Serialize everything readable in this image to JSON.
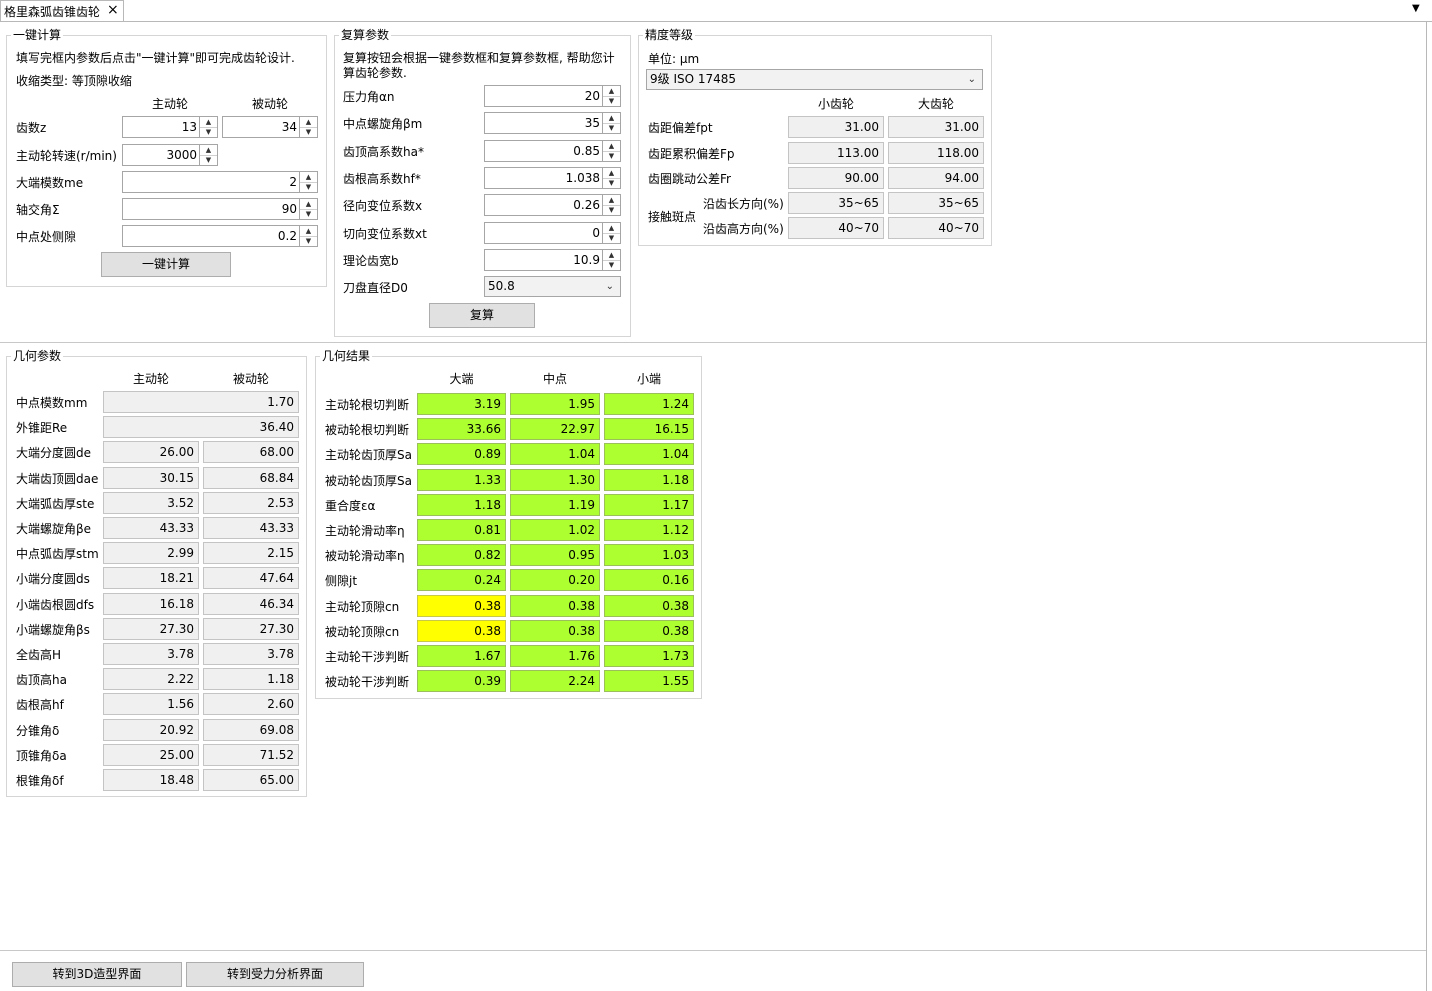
{
  "tab": {
    "title": "格里森弧齿锥齿轮",
    "close": "×"
  },
  "quick_calc": {
    "title": "一键计算",
    "hint": "填写完框内参数后点击\"一键计算\"即可完成齿轮设计.",
    "shrink_type": "收缩类型: 等顶隙收缩",
    "col_drive": "主动轮",
    "col_driven": "被动轮",
    "teeth": {
      "label": "齿数z",
      "drive": "13",
      "driven": "34"
    },
    "speed": {
      "label": "主动轮转速(r/min)",
      "value": "3000"
    },
    "module": {
      "label": "大端模数me",
      "value": "2"
    },
    "shaft_angle": {
      "label": "轴交角Σ",
      "value": "90"
    },
    "backlash": {
      "label": "中点处侧隙",
      "value": "0.2"
    },
    "button": "一键计算"
  },
  "recheck": {
    "title": "复算参数",
    "hint_line1": "复算按钮会根据一键参数框和复算参数框, 帮助您计",
    "hint_line2": "算齿轮参数.",
    "rows": [
      {
        "label": "压力角αn",
        "value": "20"
      },
      {
        "label": "中点螺旋角βm",
        "value": "35"
      },
      {
        "label": "齿顶高系数ha*",
        "value": "0.85"
      },
      {
        "label": "齿根高系数hf*",
        "value": "1.038"
      },
      {
        "label": "径向变位系数x",
        "value": "0.26"
      },
      {
        "label": "切向变位系数xt",
        "value": "0"
      },
      {
        "label": "理论齿宽b",
        "value": "10.9"
      }
    ],
    "cutter": {
      "label": "刀盘直径D0",
      "value": "50.8"
    },
    "button": "复算"
  },
  "accuracy": {
    "title": "精度等级",
    "unit": "单位: μm",
    "grade": "9级 ISO 17485",
    "col_small": "小齿轮",
    "col_large": "大齿轮",
    "rows": [
      {
        "label": "齿距偏差fpt",
        "small": "31.00",
        "large": "31.00"
      },
      {
        "label": "齿距累积偏差Fp",
        "small": "113.00",
        "large": "118.00"
      },
      {
        "label": "齿圈跳动公差Fr",
        "small": "90.00",
        "large": "94.00"
      }
    ],
    "contact_label": "接触斑点",
    "contact_rows": [
      {
        "label": "沿齿长方向(%)",
        "small": "35~65",
        "large": "35~65"
      },
      {
        "label": "沿齿高方向(%)",
        "small": "40~70",
        "large": "40~70"
      }
    ]
  },
  "geometry": {
    "title": "几何参数",
    "col_drive": "主动轮",
    "col_driven": "被动轮",
    "shared_rows": [
      {
        "label": "中点模数mm",
        "value": "1.70"
      },
      {
        "label": "外锥距Re",
        "value": "36.40"
      }
    ],
    "rows": [
      {
        "label": "大端分度圆de",
        "drive": "26.00",
        "driven": "68.00"
      },
      {
        "label": "大端齿顶圆dae",
        "drive": "30.15",
        "driven": "68.84"
      },
      {
        "label": "大端弧齿厚ste",
        "drive": "3.52",
        "driven": "2.53"
      },
      {
        "label": "大端螺旋角βe",
        "drive": "43.33",
        "driven": "43.33"
      },
      {
        "label": "中点弧齿厚stm",
        "drive": "2.99",
        "driven": "2.15"
      },
      {
        "label": "小端分度圆ds",
        "drive": "18.21",
        "driven": "47.64"
      },
      {
        "label": "小端齿根圆dfs",
        "drive": "16.18",
        "driven": "46.34"
      },
      {
        "label": "小端螺旋角βs",
        "drive": "27.30",
        "driven": "27.30"
      },
      {
        "label": "全齿高H",
        "drive": "3.78",
        "driven": "3.78"
      },
      {
        "label": "齿顶高ha",
        "drive": "2.22",
        "driven": "1.18"
      },
      {
        "label": "齿根高hf",
        "drive": "1.56",
        "driven": "2.60"
      },
      {
        "label": "分锥角δ",
        "drive": "20.92",
        "driven": "69.08"
      },
      {
        "label": "顶锥角δa",
        "drive": "25.00",
        "driven": "71.52"
      },
      {
        "label": "根锥角δf",
        "drive": "18.48",
        "driven": "65.00"
      }
    ]
  },
  "results": {
    "title": "几何结果",
    "col_big": "大端",
    "col_mid": "中点",
    "col_small": "小端",
    "green_color": "#adff2f",
    "yellow_color": "#ffff00",
    "rows": [
      {
        "label": "主动轮根切判断",
        "big": "3.19",
        "mid": "1.95",
        "small": "1.24",
        "big_status": "green"
      },
      {
        "label": "被动轮根切判断",
        "big": "33.66",
        "mid": "22.97",
        "small": "16.15",
        "big_status": "green"
      },
      {
        "label": "主动轮齿顶厚Sa",
        "big": "0.89",
        "mid": "1.04",
        "small": "1.04",
        "big_status": "green"
      },
      {
        "label": "被动轮齿顶厚Sa",
        "big": "1.33",
        "mid": "1.30",
        "small": "1.18",
        "big_status": "green"
      },
      {
        "label": "重合度εα",
        "big": "1.18",
        "mid": "1.19",
        "small": "1.17",
        "big_status": "green"
      },
      {
        "label": "主动轮滑动率η",
        "big": "0.81",
        "mid": "1.02",
        "small": "1.12",
        "big_status": "green"
      },
      {
        "label": "被动轮滑动率η",
        "big": "0.82",
        "mid": "0.95",
        "small": "1.03",
        "big_status": "green"
      },
      {
        "label": "侧隙jt",
        "big": "0.24",
        "mid": "0.20",
        "small": "0.16",
        "big_status": "green"
      },
      {
        "label": "主动轮顶隙cn",
        "big": "0.38",
        "mid": "0.38",
        "small": "0.38",
        "big_status": "yellow"
      },
      {
        "label": "被动轮顶隙cn",
        "big": "0.38",
        "mid": "0.38",
        "small": "0.38",
        "big_status": "yellow"
      },
      {
        "label": "主动轮干涉判断",
        "big": "1.67",
        "mid": "1.76",
        "small": "1.73",
        "big_status": "green"
      },
      {
        "label": "被动轮干涉判断",
        "big": "0.39",
        "mid": "2.24",
        "small": "1.55",
        "big_status": "green"
      }
    ]
  },
  "footer": {
    "btn_3d": "转到3D造型界面",
    "btn_force": "转到受力分析界面"
  }
}
